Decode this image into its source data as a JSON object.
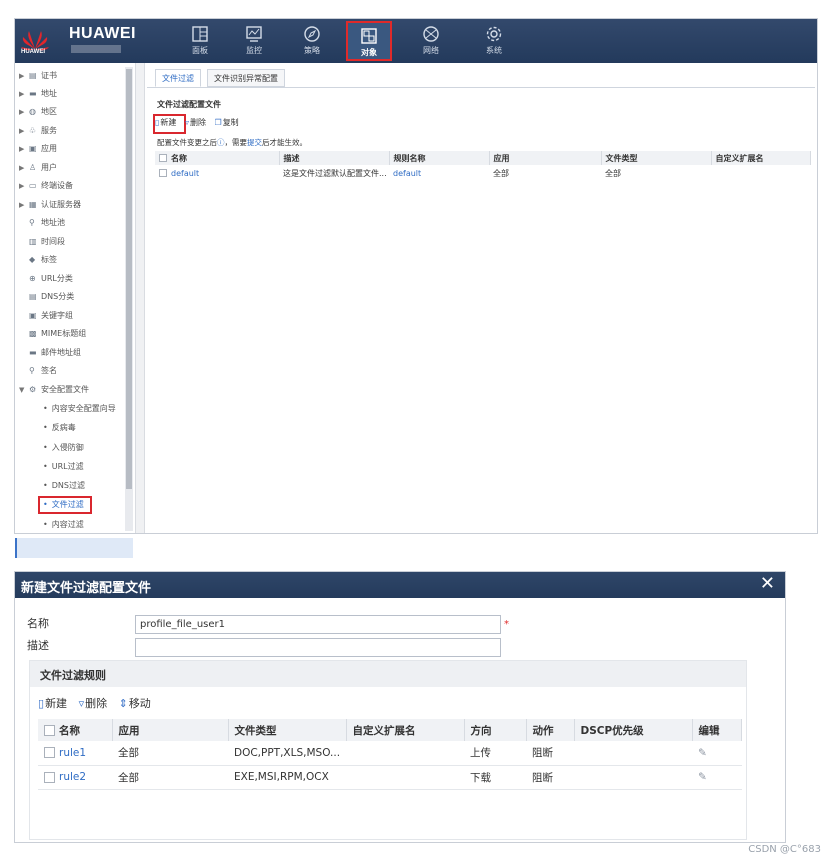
{
  "brand": {
    "name": "HUAWEI",
    "logo_word": "HUAWEI"
  },
  "nav": [
    {
      "label": "面板",
      "icon": "dashboard-icon"
    },
    {
      "label": "监控",
      "icon": "monitor-icon"
    },
    {
      "label": "策略",
      "icon": "compass-icon"
    },
    {
      "label": "对象",
      "icon": "object-icon",
      "active": true
    },
    {
      "label": "网络",
      "icon": "network-icon"
    },
    {
      "label": "系统",
      "icon": "gear-icon"
    }
  ],
  "sidebar": {
    "items": [
      {
        "label": "证书",
        "icon": "certificate-icon",
        "expandable": true
      },
      {
        "label": "地址",
        "icon": "address-icon",
        "expandable": true
      },
      {
        "label": "地区",
        "icon": "region-icon",
        "expandable": true
      },
      {
        "label": "服务",
        "icon": "service-icon",
        "expandable": true
      },
      {
        "label": "应用",
        "icon": "application-icon",
        "expandable": true
      },
      {
        "label": "用户",
        "icon": "user-icon",
        "expandable": true
      },
      {
        "label": "终端设备",
        "icon": "terminal-icon",
        "expandable": true
      },
      {
        "label": "认证服务器",
        "icon": "auth-server-icon",
        "expandable": true
      },
      {
        "label": "地址池",
        "icon": "address-pool-icon"
      },
      {
        "label": "时间段",
        "icon": "time-range-icon"
      },
      {
        "label": "标签",
        "icon": "tag-icon"
      },
      {
        "label": "URL分类",
        "icon": "url-category-icon"
      },
      {
        "label": "DNS分类",
        "icon": "dns-category-icon"
      },
      {
        "label": "关键字组",
        "icon": "keyword-icon"
      },
      {
        "label": "MIME标题组",
        "icon": "mime-icon"
      },
      {
        "label": "邮件地址组",
        "icon": "mail-icon"
      },
      {
        "label": "签名",
        "icon": "signature-icon"
      },
      {
        "label": "安全配置文件",
        "icon": "security-profile-icon",
        "expanded": true
      }
    ],
    "subitems": [
      "内容安全配置向导",
      "反病毒",
      "入侵防御",
      "URL过滤",
      "DNS过滤",
      "文件过滤",
      "内容过滤"
    ],
    "selected": "文件过滤"
  },
  "tabs": [
    "文件过滤",
    "文件识别异常配置"
  ],
  "section_title": "文件过滤配置文件",
  "toolbar": {
    "new": "新建",
    "delete": "删除",
    "copy": "复制"
  },
  "hint": {
    "prefix": "配置文件变更之后",
    "mid": "，需要",
    "link": "提交",
    "suffix": "后才能生效。"
  },
  "profile_table": {
    "headers": [
      "名称",
      "描述",
      "规则名称",
      "应用",
      "文件类型",
      "自定义扩展名"
    ],
    "rows": [
      {
        "name": "default",
        "desc": "这是文件过滤默认配置文件...",
        "rule": "default",
        "app": "全部",
        "filetype": "全部",
        "ext": ""
      }
    ]
  },
  "dialog": {
    "title": "新建文件过滤配置文件",
    "name_label": "名称",
    "name_value": "profile_file_user1",
    "desc_label": "描述",
    "desc_value": "",
    "required_mark": "*",
    "rules_title": "文件过滤规则",
    "toolbar": {
      "new": "新建",
      "delete": "删除",
      "move": "移动"
    },
    "headers": [
      "名称",
      "应用",
      "文件类型",
      "自定义扩展名",
      "方向",
      "动作",
      "DSCP优先级",
      "编辑"
    ],
    "rows": [
      {
        "name": "rule1",
        "app": "全部",
        "filetype": "DOC,PPT,XLS,MSO...",
        "ext": "",
        "direction": "上传",
        "action": "阻断",
        "dscp": ""
      },
      {
        "name": "rule2",
        "app": "全部",
        "filetype": "EXE,MSI,RPM,OCX",
        "ext": "",
        "direction": "下载",
        "action": "阻断",
        "dscp": ""
      }
    ]
  },
  "watermark": "CSDN @C°683",
  "colors": {
    "header_bg": "#2a4264",
    "accent": "#2f6cc4",
    "highlight_red": "#d9272e"
  }
}
